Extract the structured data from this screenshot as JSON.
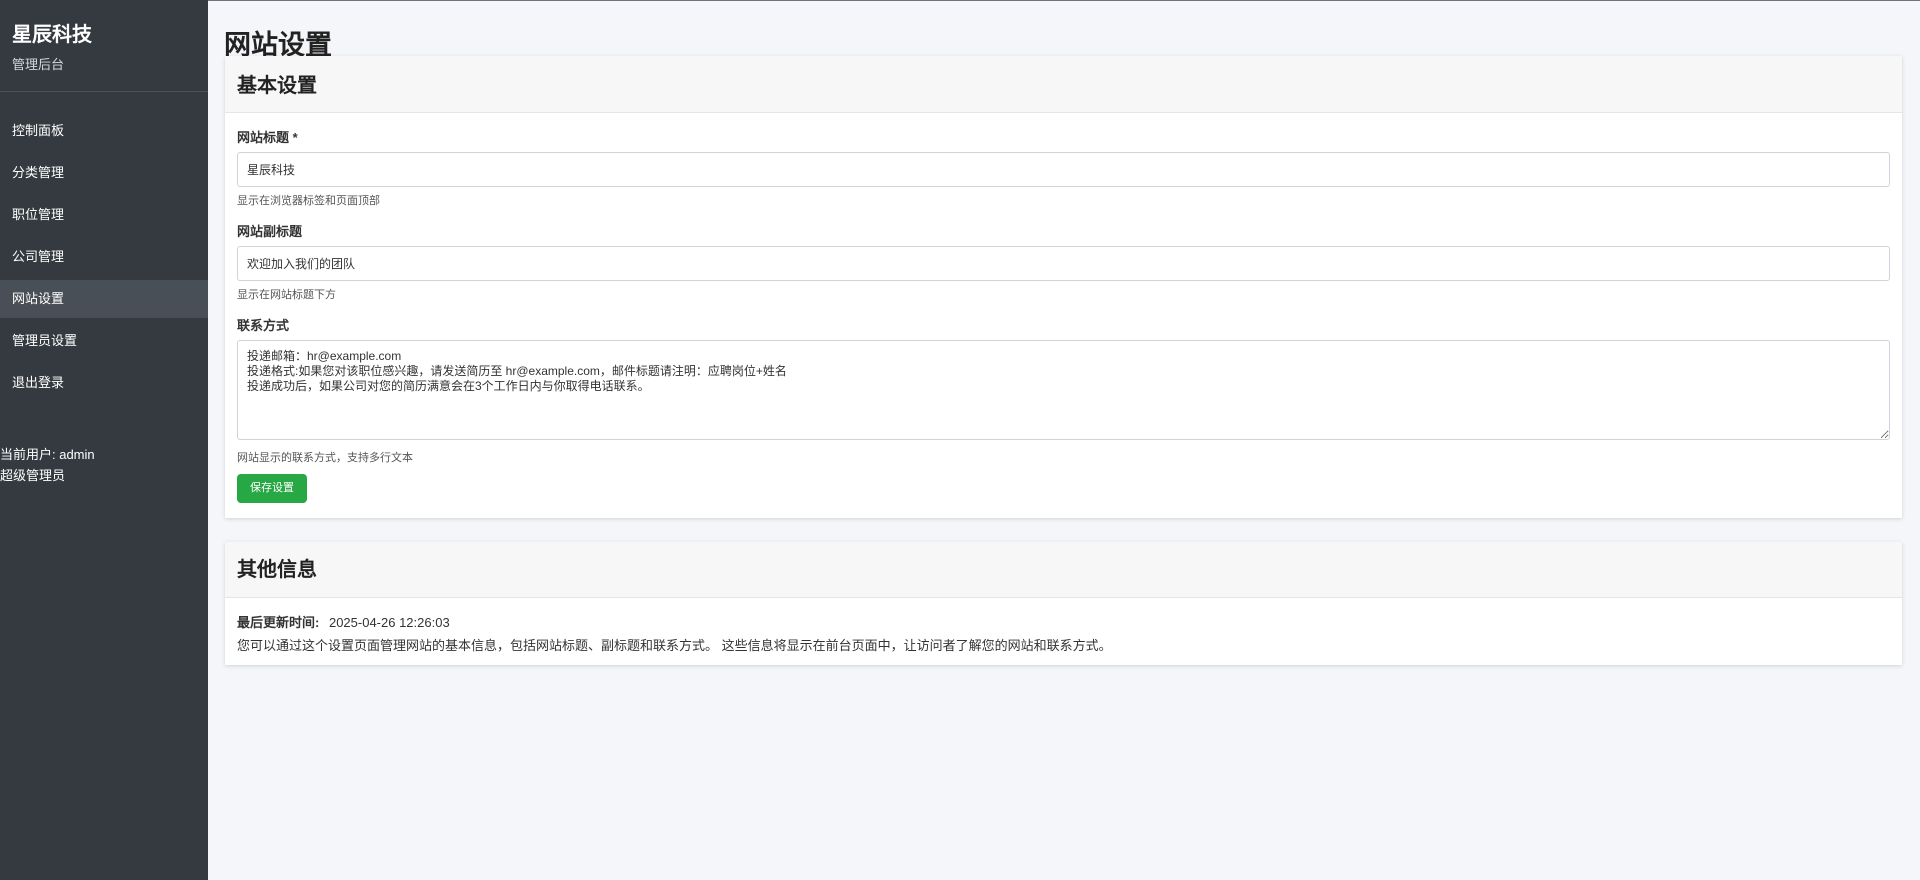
{
  "sidebar": {
    "brand_title": "星辰科技",
    "brand_subtitle": "管理后台",
    "items": [
      {
        "label": "控制面板"
      },
      {
        "label": "分类管理"
      },
      {
        "label": "职位管理"
      },
      {
        "label": "公司管理"
      },
      {
        "label": "网站设置",
        "active": true
      },
      {
        "label": "管理员设置"
      },
      {
        "label": "退出登录"
      }
    ],
    "current_user": "当前用户: admin",
    "user_role": "超级管理员"
  },
  "page": {
    "title": "网站设置"
  },
  "basic_settings": {
    "header": "基本设置",
    "site_title_label": "网站标题 *",
    "site_title_value": "星辰科技",
    "site_title_help": "显示在浏览器标签和页面顶部",
    "site_subtitle_label": "网站副标题",
    "site_subtitle_value": "欢迎加入我们的团队",
    "site_subtitle_help": "显示在网站标题下方",
    "contact_label": "联系方式",
    "contact_value": "投递邮箱：hr@example.com\n投递格式:如果您对该职位感兴趣，请发送简历至 hr@example.com，邮件标题请注明：应聘岗位+姓名\n投递成功后，如果公司对您的简历满意会在3个工作日内与你取得电话联系。",
    "contact_help": "网站显示的联系方式，支持多行文本",
    "save_label": "保存设置"
  },
  "other_info": {
    "header": "其他信息",
    "last_updated_label": "最后更新时间:",
    "last_updated_value": "2025-04-26 12:26:03",
    "description": "您可以通过这个设置页面管理网站的基本信息，包括网站标题、副标题和联系方式。 这些信息将显示在前台页面中，让访问者了解您的网站和联系方式。"
  },
  "colors": {
    "sidebar_bg": "#343a40",
    "sidebar_active": "#494f56",
    "page_bg": "#f4f6f9",
    "save_button": "#28a745"
  }
}
